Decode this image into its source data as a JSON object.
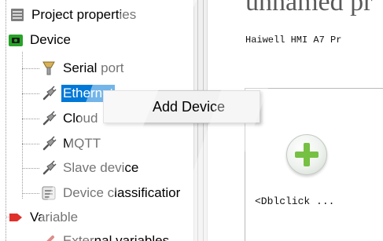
{
  "tree": {
    "items": [
      {
        "label": "Project properties",
        "icon": "project-properties-icon"
      },
      {
        "label": "Device",
        "icon": "device-icon"
      },
      {
        "label": "Serial port",
        "icon": "serial-port-icon"
      },
      {
        "label": "Ethernet",
        "icon": "ethernet-icon"
      },
      {
        "label": "Cloud",
        "icon": "cloud-plug-icon"
      },
      {
        "label": "MQTT",
        "icon": "mqtt-plug-icon"
      },
      {
        "label": "Slave device",
        "icon": "slave-device-plug-icon"
      },
      {
        "label": "Device classificatior",
        "icon": "device-classification-icon"
      },
      {
        "label": "Variable",
        "icon": "variable-icon"
      },
      {
        "label": "External variables",
        "icon": "external-variables-icon"
      }
    ]
  },
  "context_menu": {
    "add_device_label": "Add Device"
  },
  "document": {
    "title": "unnamed pr",
    "subtitle": "Haiwell HMI A7 Pr",
    "card": {
      "hint": "<Dblclick ...",
      "add_icon": "add-device-plus-icon"
    }
  },
  "colors": {
    "selection": "#0078d7",
    "device_green": "#27a327",
    "plus_green": "#76c043",
    "variable_red": "#e0302a"
  }
}
